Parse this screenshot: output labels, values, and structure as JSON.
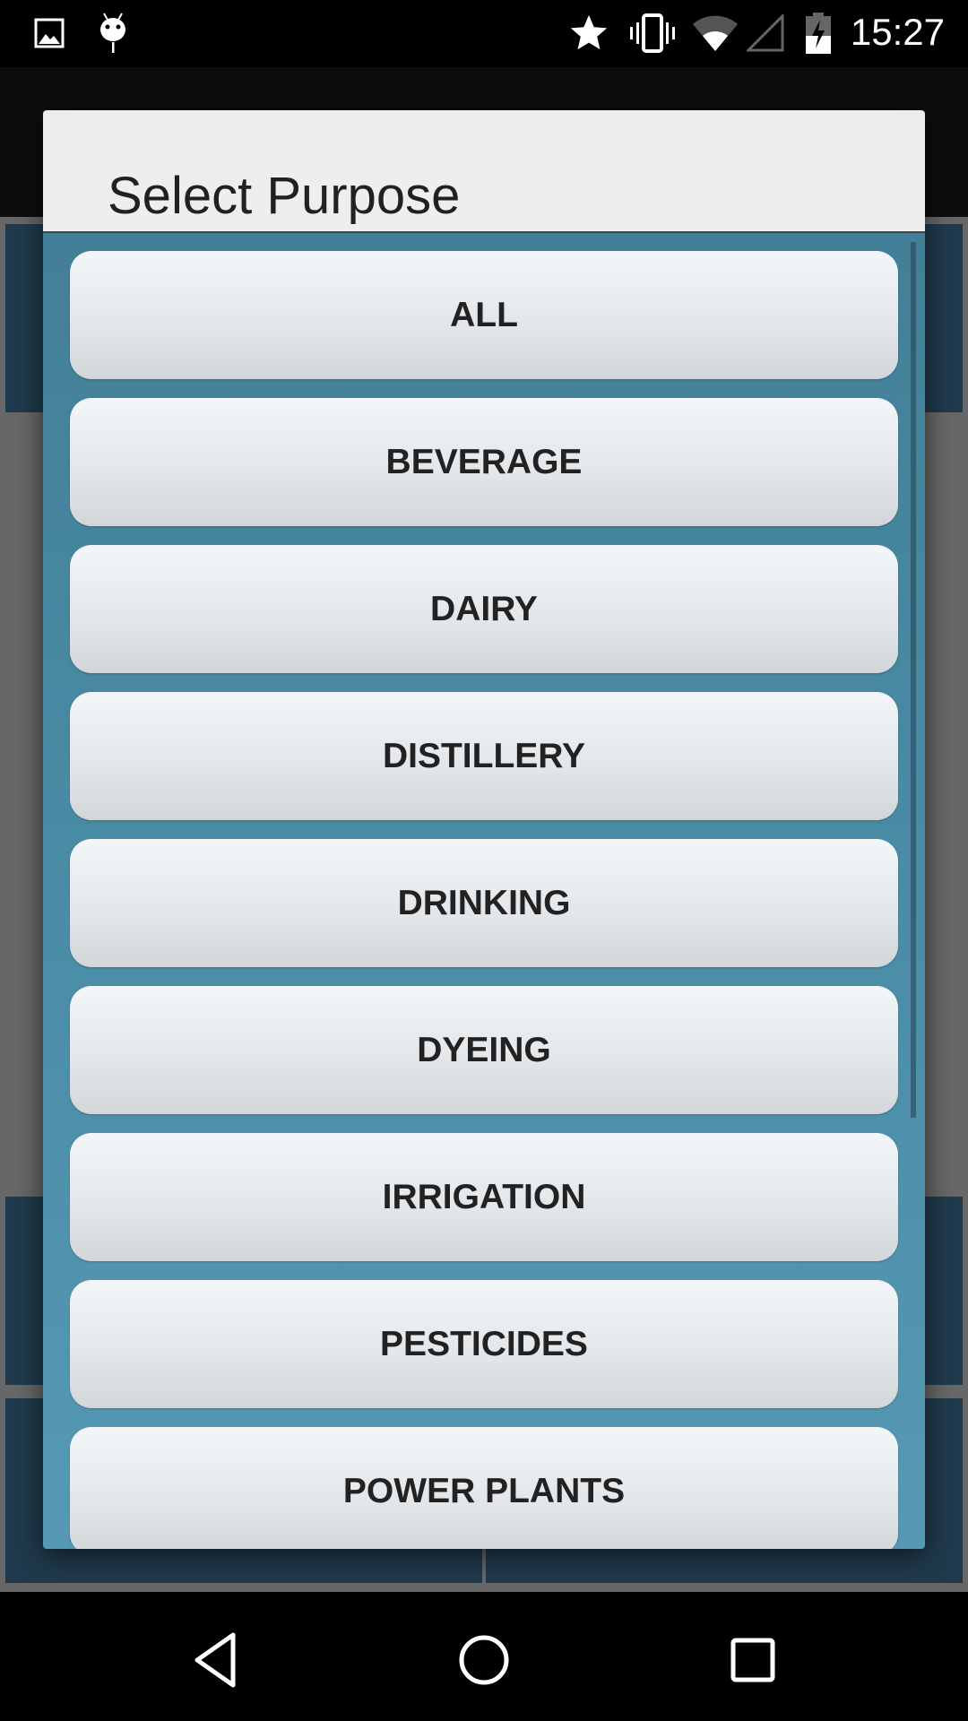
{
  "status_bar": {
    "time": "15:27",
    "left_icons": [
      "image-icon",
      "android-debug-icon"
    ],
    "right_icons": [
      "star-icon",
      "vibrate-icon",
      "wifi-icon",
      "signal-icon",
      "battery-charging-icon"
    ]
  },
  "dialog": {
    "title": "Select Purpose",
    "options": [
      "ALL",
      "BEVERAGE",
      "DAIRY",
      "DISTILLERY",
      "DRINKING",
      "DYEING",
      "IRRIGATION",
      "PESTICIDES",
      "POWER PLANTS"
    ]
  },
  "nav_bar": {
    "icons": [
      "back-icon",
      "home-icon",
      "recents-icon"
    ]
  },
  "colors": {
    "list_background": "#4a8ca6",
    "title_background": "#eeeeee",
    "button_text": "#222222"
  }
}
